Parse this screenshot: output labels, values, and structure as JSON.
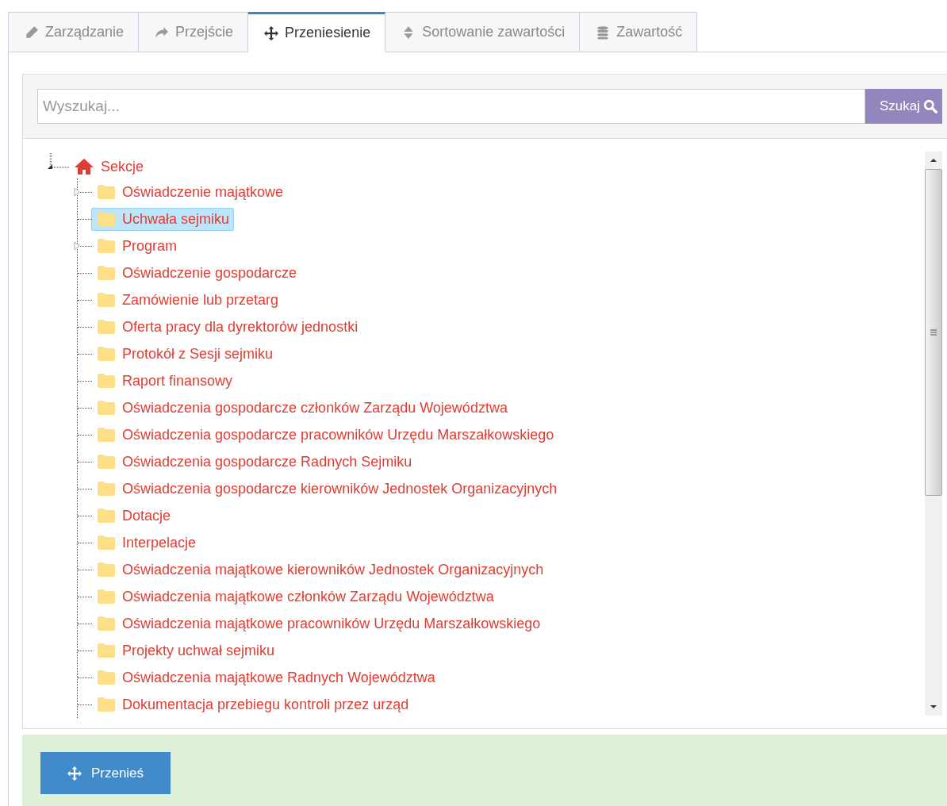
{
  "tabs": [
    {
      "label": "Zarządzanie",
      "kind": "pencil",
      "selected": false
    },
    {
      "label": "Przejście",
      "kind": "share",
      "selected": false
    },
    {
      "label": "Przeniesienie",
      "kind": "move",
      "selected": true
    },
    {
      "label": "Sortowanie zawartości",
      "kind": "sort",
      "selected": false
    },
    {
      "label": "Zawartość",
      "kind": "database",
      "selected": false
    }
  ],
  "search": {
    "placeholder": "Wyszukaj...",
    "button": "Szukaj"
  },
  "tree": {
    "label": "Sekcje",
    "children": [
      {
        "label": "Oświadczenie majątkowe",
        "selected": false,
        "collapsed": true
      },
      {
        "label": "Uchwała sejmiku",
        "selected": true,
        "collapsed": false
      },
      {
        "label": "Program",
        "selected": false,
        "collapsed": true
      },
      {
        "label": "Oświadczenie gospodarcze",
        "selected": false,
        "collapsed": false
      },
      {
        "label": "Zamówienie lub przetarg",
        "selected": false,
        "collapsed": false
      },
      {
        "label": "Oferta pracy dla dyrektorów jednostki",
        "selected": false,
        "collapsed": false
      },
      {
        "label": "Protokół z Sesji sejmiku",
        "selected": false,
        "collapsed": false
      },
      {
        "label": "Raport finansowy",
        "selected": false,
        "collapsed": false
      },
      {
        "label": "Oświadczenia gospodarcze członków Zarządu Województwa",
        "selected": false,
        "collapsed": false
      },
      {
        "label": "Oświadczenia gospodarcze pracowników Urzędu Marszałkowskiego",
        "selected": false,
        "collapsed": false
      },
      {
        "label": "Oświadczenia gospodarcze Radnych Sejmiku",
        "selected": false,
        "collapsed": false
      },
      {
        "label": "Oświadczenia gospodarcze kierowników Jednostek Organizacyjnych",
        "selected": false,
        "collapsed": false
      },
      {
        "label": "Dotacje",
        "selected": false,
        "collapsed": false
      },
      {
        "label": "Interpelacje",
        "selected": false,
        "collapsed": false
      },
      {
        "label": "Oświadczenia majątkowe kierowników Jednostek Organizacyjnych",
        "selected": false,
        "collapsed": false
      },
      {
        "label": "Oświadczenia majątkowe członków Zarządu Województwa",
        "selected": false,
        "collapsed": false
      },
      {
        "label": "Oświadczenia majątkowe pracowników Urzędu Marszałkowskiego",
        "selected": false,
        "collapsed": false
      },
      {
        "label": "Projekty uchwał sejmiku",
        "selected": false,
        "collapsed": false
      },
      {
        "label": "Oświadczenia majątkowe Radnych Województwa",
        "selected": false,
        "collapsed": false
      },
      {
        "label": "Dokumentacja przebiegu kontroli przez urząd",
        "selected": false,
        "collapsed": false
      }
    ]
  },
  "action_button": "Przenieś"
}
